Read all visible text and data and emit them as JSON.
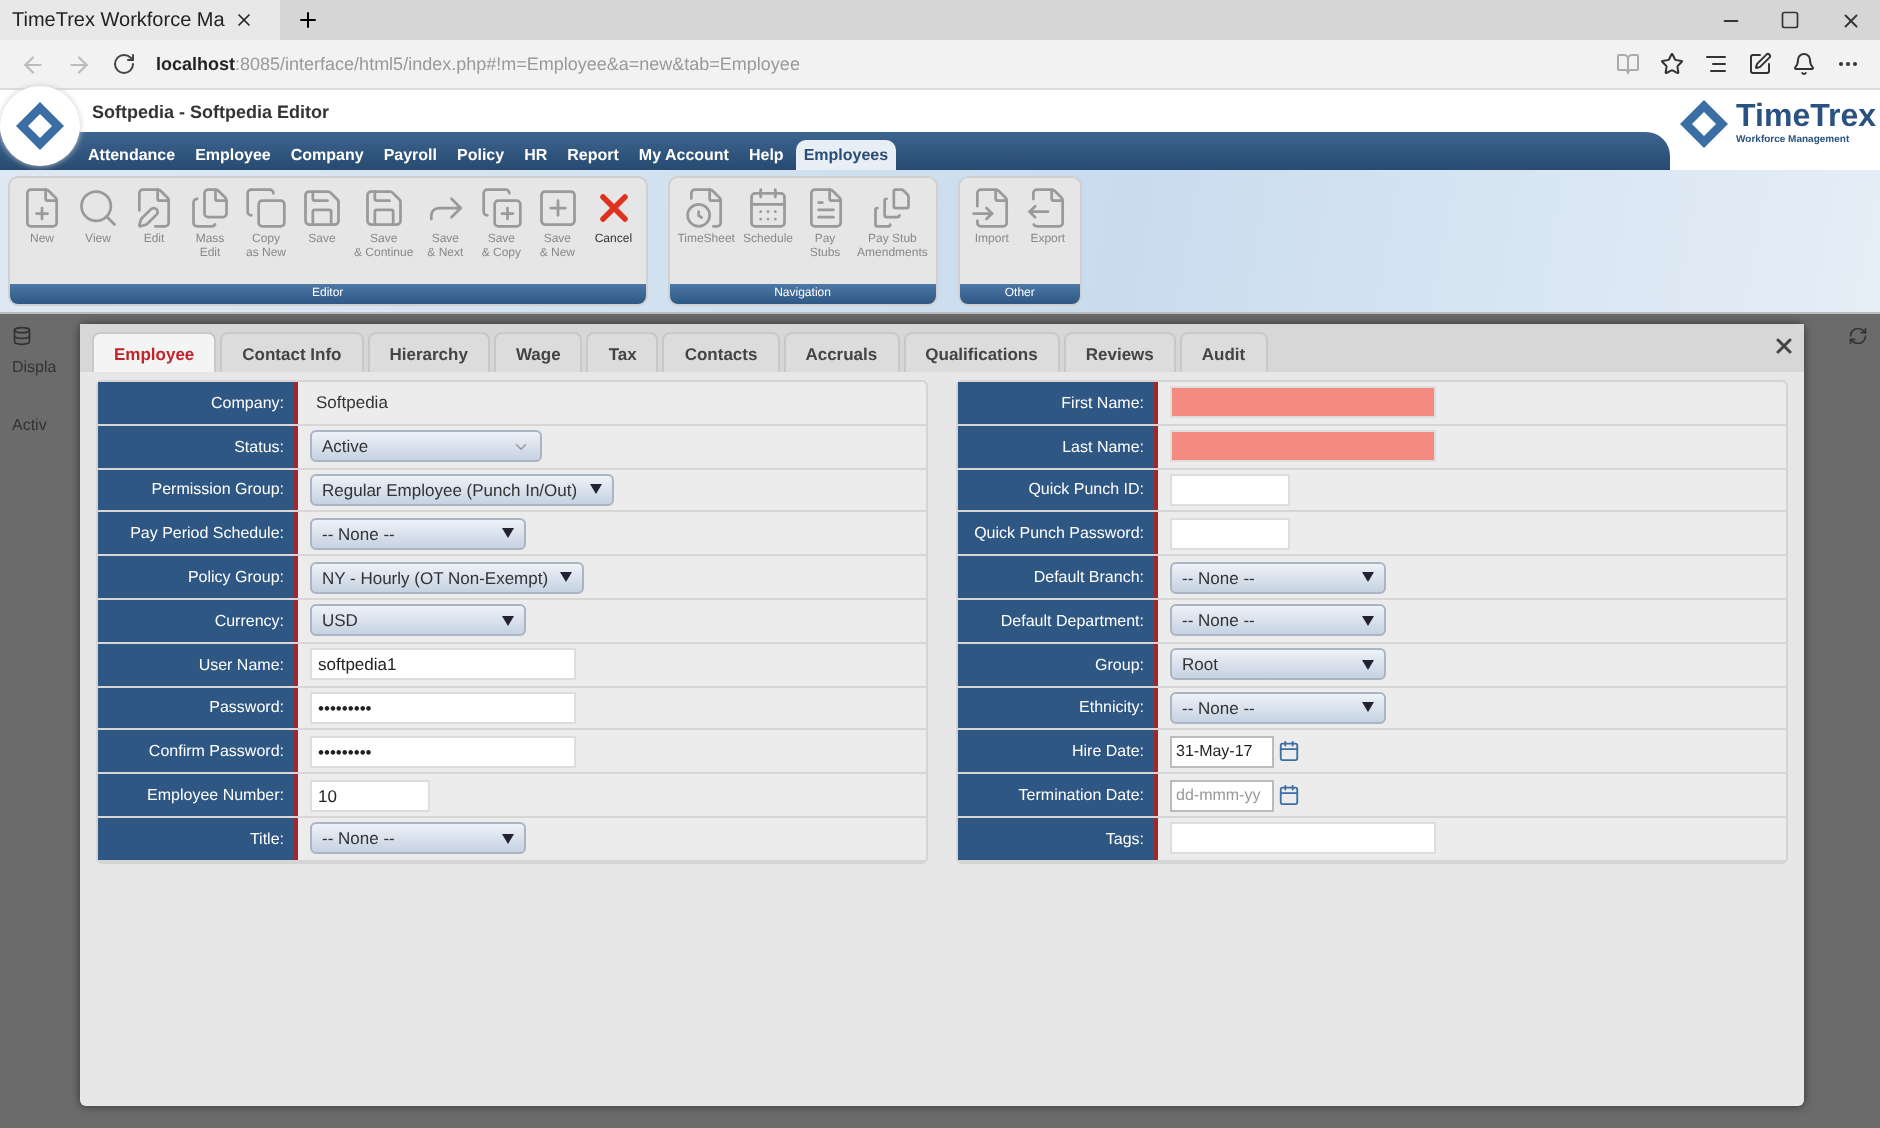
{
  "browser": {
    "tab_title": "TimeTrex Workforce Ma",
    "url_host": "localhost",
    "url_rest": ":8085/interface/html5/index.php#!m=Employee&a=new&tab=Employee"
  },
  "app": {
    "title": "Softpedia - Softpedia Editor",
    "logo_name": "TimeTrex",
    "logo_tagline": "Workforce Management"
  },
  "menu": [
    {
      "label": "Attendance",
      "selected": false
    },
    {
      "label": "Employee",
      "selected": false
    },
    {
      "label": "Company",
      "selected": false
    },
    {
      "label": "Payroll",
      "selected": false
    },
    {
      "label": "Policy",
      "selected": false
    },
    {
      "label": "HR",
      "selected": false
    },
    {
      "label": "Report",
      "selected": false
    },
    {
      "label": "My Account",
      "selected": false
    },
    {
      "label": "Help",
      "selected": false
    },
    {
      "label": "Employees",
      "selected": true
    }
  ],
  "toolbar": [
    {
      "title": "Editor",
      "buttons": [
        {
          "label": "New",
          "disabled": true
        },
        {
          "label": "View",
          "disabled": true
        },
        {
          "label": "Edit",
          "disabled": true
        },
        {
          "label": "Mass\nEdit",
          "disabled": true
        },
        {
          "label": "Copy\nas New",
          "disabled": true
        },
        {
          "label": "Save",
          "disabled": true
        },
        {
          "label": "Save\n& Continue",
          "disabled": true
        },
        {
          "label": "Save\n& Next",
          "disabled": true
        },
        {
          "label": "Save\n& Copy",
          "disabled": true
        },
        {
          "label": "Save\n& New",
          "disabled": true
        },
        {
          "label": "Cancel",
          "disabled": false
        }
      ]
    },
    {
      "title": "Navigation",
      "buttons": [
        {
          "label": "TimeSheet",
          "disabled": true
        },
        {
          "label": "Schedule",
          "disabled": true
        },
        {
          "label": "Pay\nStubs",
          "disabled": true
        },
        {
          "label": "Pay Stub\nAmendments",
          "disabled": true
        }
      ]
    },
    {
      "title": "Other",
      "buttons": [
        {
          "label": "Import",
          "disabled": true
        },
        {
          "label": "Export",
          "disabled": true
        }
      ]
    }
  ],
  "background": {
    "filter_label": "Displa",
    "row_label": "Activ"
  },
  "dialog": {
    "tabs": [
      {
        "label": "Employee",
        "selected": true
      },
      {
        "label": "Contact Info",
        "selected": false
      },
      {
        "label": "Hierarchy",
        "selected": false
      },
      {
        "label": "Wage",
        "selected": false
      },
      {
        "label": "Tax",
        "selected": false
      },
      {
        "label": "Contacts",
        "selected": false
      },
      {
        "label": "Accruals",
        "selected": false
      },
      {
        "label": "Qualifications",
        "selected": false
      },
      {
        "label": "Reviews",
        "selected": false
      },
      {
        "label": "Audit",
        "selected": false
      }
    ],
    "left_fields": [
      {
        "label": "Company:",
        "kind": "static",
        "value": "Softpedia"
      },
      {
        "label": "Status:",
        "kind": "combo",
        "value": "Active"
      },
      {
        "label": "Permission Group:",
        "kind": "select",
        "value": "Regular Employee (Punch In/Out)"
      },
      {
        "label": "Pay Period Schedule:",
        "kind": "select",
        "value": "-- None --"
      },
      {
        "label": "Policy Group:",
        "kind": "select",
        "value": "NY - Hourly (OT Non-Exempt)"
      },
      {
        "label": "Currency:",
        "kind": "select",
        "value": "USD"
      },
      {
        "label": "User Name:",
        "kind": "input",
        "value": "softpedia1"
      },
      {
        "label": "Password:",
        "kind": "input",
        "value": "•••••••••"
      },
      {
        "label": "Confirm Password:",
        "kind": "input",
        "value": "•••••••••"
      },
      {
        "label": "Employee Number:",
        "kind": "shortinput",
        "value": "10"
      },
      {
        "label": "Title:",
        "kind": "select",
        "value": "-- None --"
      }
    ],
    "right_fields": [
      {
        "label": "First Name:",
        "kind": "input",
        "required": true
      },
      {
        "label": "Last Name:",
        "kind": "input",
        "required": true
      },
      {
        "label": "Quick Punch ID:",
        "kind": "shortinput"
      },
      {
        "label": "Quick Punch Password:",
        "kind": "shortinput"
      },
      {
        "label": "Default Branch:",
        "kind": "select",
        "value": "-- None --"
      },
      {
        "label": "Default Department:",
        "kind": "select",
        "value": "-- None --"
      },
      {
        "label": "Group:",
        "kind": "select",
        "value": "Root"
      },
      {
        "label": "Ethnicity:",
        "kind": "select",
        "value": "-- None --"
      },
      {
        "label": "Hire Date:",
        "kind": "date",
        "value": "31-May-17"
      },
      {
        "label": "Termination Date:",
        "kind": "date",
        "placeholder": "dd-mmm-yy"
      },
      {
        "label": "Tags:",
        "kind": "input"
      }
    ]
  }
}
